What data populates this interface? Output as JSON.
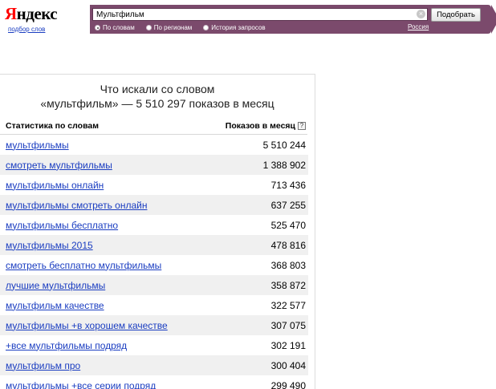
{
  "logo": {
    "first_letter": "Я",
    "rest": "ндекс"
  },
  "logo_sub_link": "подбор слов",
  "search": {
    "value": "Мультфильм",
    "clear_symbol": "×",
    "submit_label": "Подобрать",
    "modes": [
      {
        "label": "По словам",
        "selected": true
      },
      {
        "label": "По регионам",
        "selected": false
      },
      {
        "label": "История запросов",
        "selected": false
      }
    ],
    "region": "Россия"
  },
  "results": {
    "title_line1": "Что искали со словом",
    "title_line2": "«мультфильм» — 5 510 297 показов в месяц",
    "col_phrase": "Статистика по словам",
    "col_count": "Показов в месяц",
    "help_symbol": "?",
    "rows": [
      {
        "phrase": "мультфильмы",
        "count": "5 510 244"
      },
      {
        "phrase": "смотреть мультфильмы",
        "count": "1 388 902"
      },
      {
        "phrase": "мультфильмы онлайн",
        "count": "713 436"
      },
      {
        "phrase": "мультфильмы смотреть онлайн",
        "count": "637 255"
      },
      {
        "phrase": "мультфильмы бесплатно",
        "count": "525 470"
      },
      {
        "phrase": "мультфильмы 2015",
        "count": "478 816"
      },
      {
        "phrase": "смотреть бесплатно мультфильмы",
        "count": "368 803"
      },
      {
        "phrase": "лучшие мультфильмы",
        "count": "358 872"
      },
      {
        "phrase": "мультфильм качестве",
        "count": "322 577"
      },
      {
        "phrase": "мультфильмы +в хорошем качестве",
        "count": "307 075"
      },
      {
        "phrase": "+все мультфильмы подряд",
        "count": "302 191"
      },
      {
        "phrase": "мультфильм про",
        "count": "300 404"
      },
      {
        "phrase": "мультфильмы +все серии подряд",
        "count": "299 490"
      }
    ]
  }
}
